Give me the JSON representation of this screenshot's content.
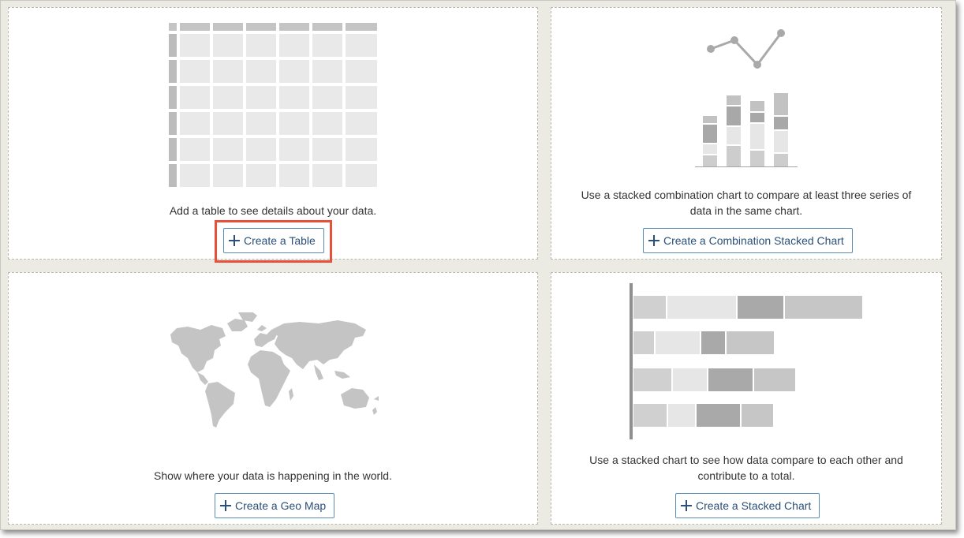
{
  "tiles": {
    "table": {
      "description": "Add a table to see details about your data.",
      "button_label": "Create a Table",
      "illustration": "table-grid-icon"
    },
    "combination": {
      "description_line1": "Use a stacked combination chart to compare at least three series of",
      "description_line2": "data in the same chart.",
      "button_label": "Create a Combination Stacked Chart",
      "illustration": "combination-chart-icon"
    },
    "geo": {
      "description": "Show where your data is happening in the world.",
      "button_label": "Create a Geo Map",
      "illustration": "world-map-icon"
    },
    "stacked": {
      "description_line1": "Use a stacked chart to see how data compare to each other and",
      "description_line2": "contribute to a total.",
      "button_label": "Create a Stacked Chart",
      "illustration": "stacked-bar-chart-icon"
    }
  },
  "colors": {
    "highlight": "#e8503a",
    "button_border": "#5a8bb5",
    "button_text": "#2a4f78"
  }
}
